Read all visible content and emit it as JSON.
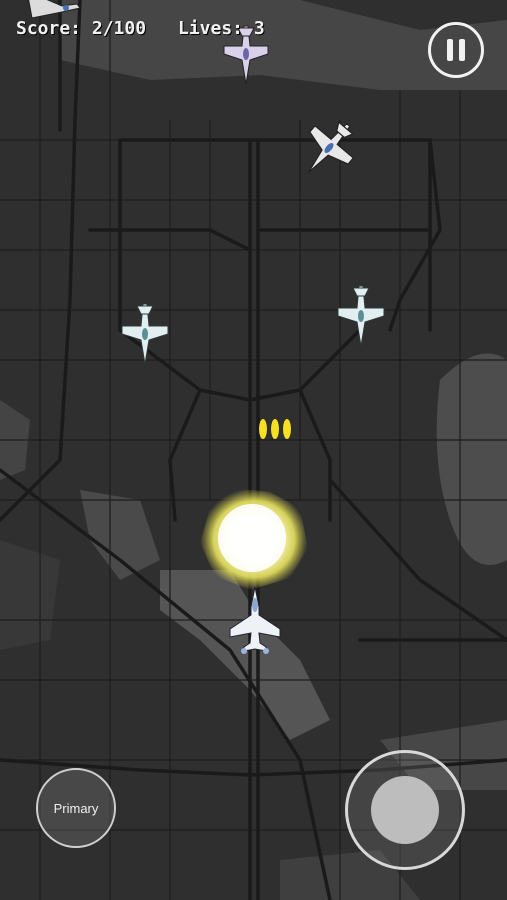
{
  "hud": {
    "score_label": "Score: 2/100",
    "lives_label": "Lives: 3"
  },
  "controls": {
    "primary_label": "Primary",
    "pause_icon": "pause-icon",
    "joystick": "virtual-joystick"
  },
  "colors": {
    "background": "#2e2e2e",
    "road": "#1c1c1c",
    "block": "#3a3a3a",
    "water": "#4d4d4d",
    "hud_text": "#f2f2f2",
    "bullet": "#f5e022",
    "explosion": "#fffbd0"
  },
  "entities": {
    "player": "player-jet",
    "enemies": [
      "enemy-jet",
      "enemy-jet",
      "enemy-jet",
      "enemy-jet",
      "enemy-jet"
    ],
    "bullets": 3,
    "explosion": "explosion"
  }
}
